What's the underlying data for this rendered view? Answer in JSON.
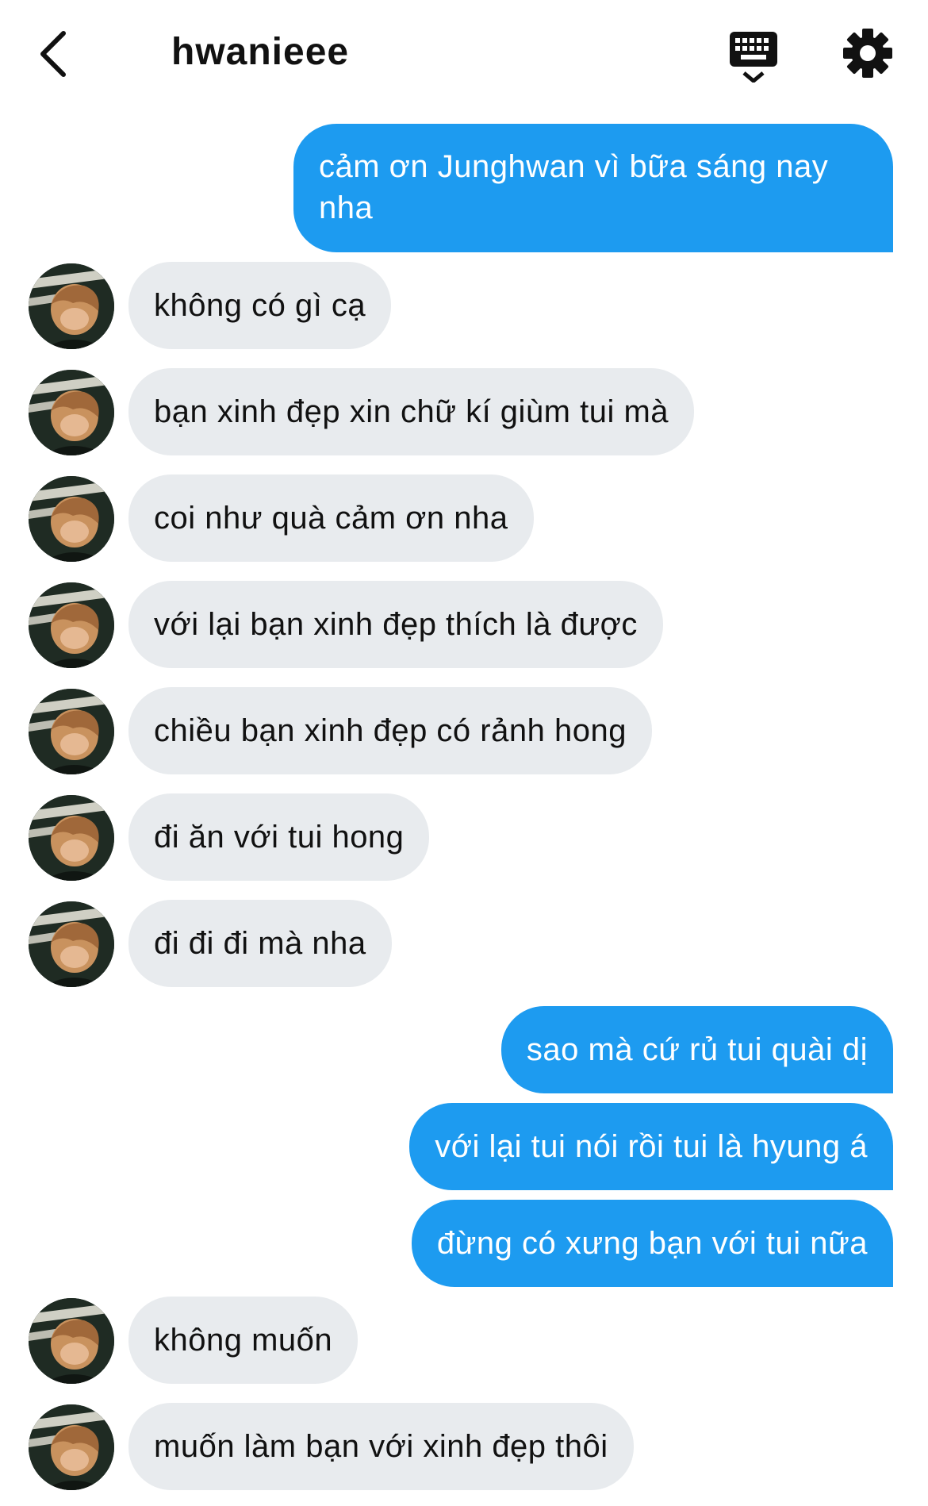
{
  "header": {
    "title": "hwanieee",
    "back_icon": "chevron-left-icon",
    "keyboard_icon": "keyboard-icon",
    "settings_icon": "gear-icon"
  },
  "colors": {
    "outgoing_bubble": "#1d9bf0",
    "incoming_bubble": "#e8ebee",
    "background": "#ffffff"
  },
  "messages": [
    {
      "from": "me",
      "text": "cảm ơn Junghwan vì bữa sáng nay nha"
    },
    {
      "from": "them",
      "text": "không có gì cạ"
    },
    {
      "from": "them",
      "text": "bạn xinh đẹp xin chữ kí giùm tui mà"
    },
    {
      "from": "them",
      "text": "coi như quà cảm ơn nha"
    },
    {
      "from": "them",
      "text": "với lại bạn xinh đẹp thích là được"
    },
    {
      "from": "them",
      "text": "chiều bạn xinh đẹp có rảnh hong"
    },
    {
      "from": "them",
      "text": "đi ăn với tui hong"
    },
    {
      "from": "them",
      "text": "đi đi đi mà nha"
    },
    {
      "from": "me",
      "text": "sao mà cứ rủ tui quài dị"
    },
    {
      "from": "me",
      "text": "với lại tui nói rồi tui là hyung á"
    },
    {
      "from": "me",
      "text": "đừng có xưng bạn với tui nữa"
    },
    {
      "from": "them",
      "text": "không muốn"
    },
    {
      "from": "them",
      "text": "muốn làm bạn với xinh đẹp thôi"
    }
  ]
}
